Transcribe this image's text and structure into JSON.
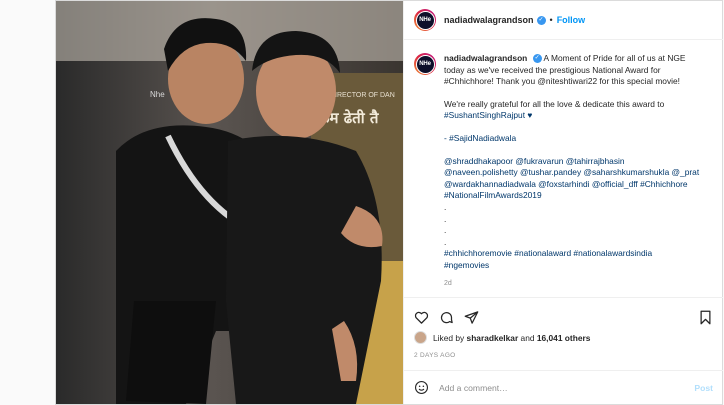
{
  "post": {
    "username": "nadiadwalagrandson",
    "follow_label": "Follow",
    "avatar_text": "NHe",
    "caption_lines": [
      "A Moment of Pride for all of us at NGE",
      "today as we've received the prestigious National Award for",
      "#Chhichhore! Thank you @niteshtiwari22 for this special movie!"
    ],
    "para2": [
      "We're really grateful for all the love & dedicate this award to",
      "#SushantSinghRajput ♥"
    ],
    "signature": "- #SajidNadiadwala",
    "mentions": [
      "@shraddhakapoor @fukravarun @tahirrajbhasin",
      "@naveen.polishetty @tushar.pandey @saharshkumarshukla @_prat",
      "@wardakhannadiadwala @foxstarhindi @official_dff #Chhichhore",
      "#NationalFilmAwards2019"
    ],
    "dots": [
      ".",
      ".",
      ".",
      "."
    ],
    "hashtags": [
      "#chhichhoremovie #nationalaward #nationalawardsindia",
      "#ngemovies"
    ],
    "caption_time": "2d",
    "likes_prefix": "Liked by",
    "likes_user": "sharadkelkar",
    "likes_and": "and",
    "likes_count": "16,041 others",
    "time_ago": "2 DAYS AGO",
    "comment_placeholder": "Add a comment…",
    "post_label": "Post"
  },
  "photo": {
    "poster_text": "THE DIRECTOR OF DAN",
    "poster_hindi": "कम ढेती तै",
    "poster_logo": "Nhe"
  },
  "colors": {
    "link": "#00376b",
    "accent": "#0095f6",
    "verified": "#3897f0"
  }
}
